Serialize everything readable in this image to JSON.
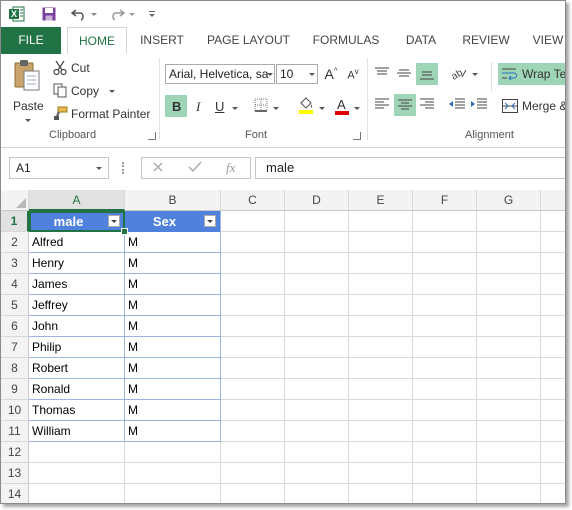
{
  "colors": {
    "excel_green": "#217346",
    "header_blue": "#4f81dd",
    "table_border": "#9bb5e3",
    "button_highlight": "#9fd5b7"
  },
  "tabs": [
    "FILE",
    "HOME",
    "INSERT",
    "PAGE LAYOUT",
    "FORMULAS",
    "DATA",
    "REVIEW",
    "VIEW"
  ],
  "clipboard": {
    "paste": "Paste",
    "cut": "Cut",
    "copy": "Copy",
    "format_painter": "Format Painter",
    "label": "Clipboard"
  },
  "font": {
    "name": "Arial, Helvetica, sa",
    "size": "10",
    "label": "Font",
    "bold": "B",
    "italic": "I",
    "underline": "U",
    "grow": "A",
    "shrink": "A",
    "color_a": "A"
  },
  "alignment": {
    "wrap_text": "Wrap Te",
    "merge": "Merge &",
    "label": "Alignment"
  },
  "formula_bar": {
    "name_box": "A1",
    "fx": "fx",
    "value": "male"
  },
  "columns": [
    "A",
    "B",
    "C",
    "D",
    "E",
    "F",
    "G"
  ],
  "rows": [
    "1",
    "2",
    "3",
    "4",
    "5",
    "6",
    "7",
    "8",
    "9",
    "10",
    "11",
    "12",
    "13",
    "14"
  ],
  "table": {
    "headers": [
      "male",
      "Sex"
    ],
    "rows": [
      [
        "Alfred",
        "M"
      ],
      [
        "Henry",
        "M"
      ],
      [
        "James",
        "M"
      ],
      [
        "Jeffrey",
        "M"
      ],
      [
        "John",
        "M"
      ],
      [
        "Philip",
        "M"
      ],
      [
        "Robert",
        "M"
      ],
      [
        "Ronald",
        "M"
      ],
      [
        "Thomas",
        "M"
      ],
      [
        "William",
        "M"
      ]
    ]
  }
}
